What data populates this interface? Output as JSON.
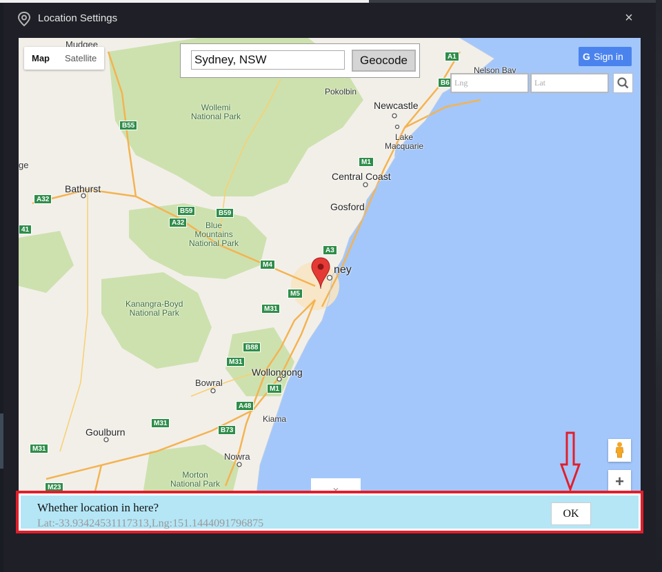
{
  "dialog": {
    "title": "Location Settings",
    "close_label": "×"
  },
  "map_type": {
    "map_label": "Map",
    "satellite_label": "Satellite",
    "selected": "Map"
  },
  "geocode": {
    "input_value": "Sydney, NSW",
    "button_label": "Geocode"
  },
  "sign_in": {
    "icon_letter": "G",
    "label": "Sign in"
  },
  "coords": {
    "lng_placeholder": "Lng",
    "lat_placeholder": "Lat"
  },
  "map_labels": {
    "mudgee": "Mudgee",
    "bathurst": "Bathurst",
    "wollemi": "Wollemi\nNational Park",
    "blue_mountains": "Blue\nMountains\nNational Park",
    "kanangra": "Kanangra-Boyd\nNational Park",
    "morton": "Morton\nNational Park",
    "newcastle": "Newcastle",
    "nelson_bay": "Nelson Bay",
    "pokolbin": "Pokolbin",
    "lake_macquarie": "Lake\nMacquarie",
    "central_coast": "Central Coast",
    "gosford": "Gosford",
    "sydney": "ney",
    "wollongong": "Wollongong",
    "bowral": "Bowral",
    "kiama": "Kiama",
    "goulburn": "Goulburn",
    "nowra": "Nowra",
    "edge_left": "ge"
  },
  "road_shields": {
    "a1": "A1",
    "b6": "B6",
    "b55": "B55",
    "a32a": "A32",
    "a32b": "A32",
    "a41": "41",
    "b59a": "B59",
    "b59b": "B59",
    "m1a": "M1",
    "m1b": "M1",
    "a3": "A3",
    "m4": "M4",
    "m5": "M5",
    "m31a": "M31",
    "m31b": "M31",
    "m31c": "M31",
    "m31d": "M31",
    "b88": "B88",
    "a48": "A48",
    "b73": "B73",
    "m23": "M23"
  },
  "confirm": {
    "question": "Whether location in here?",
    "latlng": "Lat:-33.93424531117313,Lng:151.1444091796875",
    "ok_label": "OK"
  },
  "colors": {
    "accent_red": "#e01f2b",
    "confirm_bg": "#b4e6f6",
    "sign_in_blue": "#4b83ee",
    "water": "#a3c7fb",
    "land": "#f2efe9",
    "park": "#cde1ae"
  },
  "icons": {
    "title": "location-pin-icon",
    "close": "close-icon",
    "search": "search-icon",
    "marker": "map-marker-icon",
    "pegman": "street-view-pegman-icon",
    "zoom_in": "plus-icon",
    "expand": "chevron-down-icon",
    "annotation": "down-arrow-icon"
  }
}
